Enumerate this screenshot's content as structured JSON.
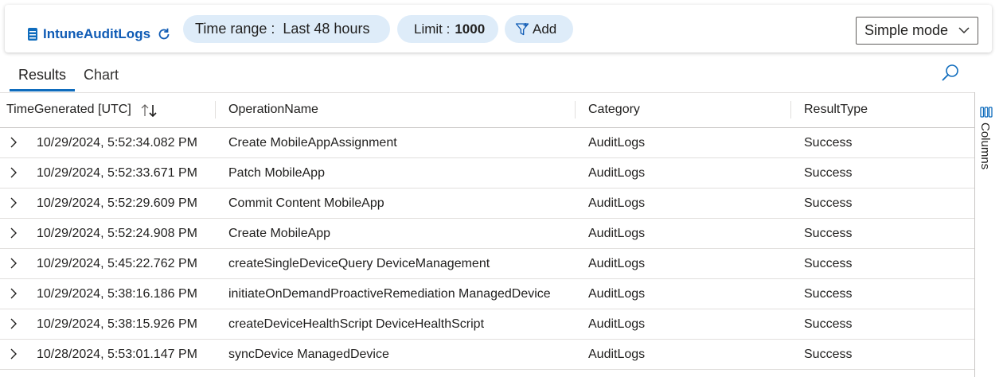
{
  "toolbar": {
    "table_name": "IntuneAuditLogs",
    "time_range_label": "Time range :",
    "time_range_value": "Last 48 hours",
    "limit_label": "Limit :",
    "limit_value": "1000",
    "add_label": "Add",
    "mode_value": "Simple mode"
  },
  "tabs": [
    {
      "label": "Results",
      "active": true
    },
    {
      "label": "Chart",
      "active": false
    }
  ],
  "table": {
    "columns": [
      "TimeGenerated [UTC]",
      "OperationName",
      "Category",
      "ResultType"
    ],
    "rows": [
      {
        "time": "10/29/2024, 5:52:34.082 PM",
        "operation": "Create MobileAppAssignment",
        "category": "AuditLogs",
        "result": "Success"
      },
      {
        "time": "10/29/2024, 5:52:33.671 PM",
        "operation": "Patch MobileApp",
        "category": "AuditLogs",
        "result": "Success"
      },
      {
        "time": "10/29/2024, 5:52:29.609 PM",
        "operation": "Commit Content MobileApp",
        "category": "AuditLogs",
        "result": "Success"
      },
      {
        "time": "10/29/2024, 5:52:24.908 PM",
        "operation": "Create MobileApp",
        "category": "AuditLogs",
        "result": "Success"
      },
      {
        "time": "10/29/2024, 5:45:22.762 PM",
        "operation": "createSingleDeviceQuery DeviceManagement",
        "category": "AuditLogs",
        "result": "Success"
      },
      {
        "time": "10/29/2024, 5:38:16.186 PM",
        "operation": "initiateOnDemandProactiveRemediation ManagedDevice",
        "category": "AuditLogs",
        "result": "Success"
      },
      {
        "time": "10/29/2024, 5:38:15.926 PM",
        "operation": "createDeviceHealthScript DeviceHealthScript",
        "category": "AuditLogs",
        "result": "Success"
      },
      {
        "time": "10/28/2024, 5:53:01.147 PM",
        "operation": "syncDevice ManagedDevice",
        "category": "AuditLogs",
        "result": "Success"
      }
    ]
  },
  "side_rail": {
    "columns_label": "Columns"
  },
  "icons": {
    "table": "database-icon",
    "refresh": "refresh-icon",
    "filter": "funnel-icon",
    "dropdown": "chevron-down-icon",
    "search": "search-icon",
    "sort": "sort-icon",
    "expand": "chevron-right-icon",
    "columns": "columns-icon"
  },
  "colors": {
    "accent": "#0f6cbd",
    "link": "#0f5bb5",
    "pill_bg": "#deecf9"
  }
}
